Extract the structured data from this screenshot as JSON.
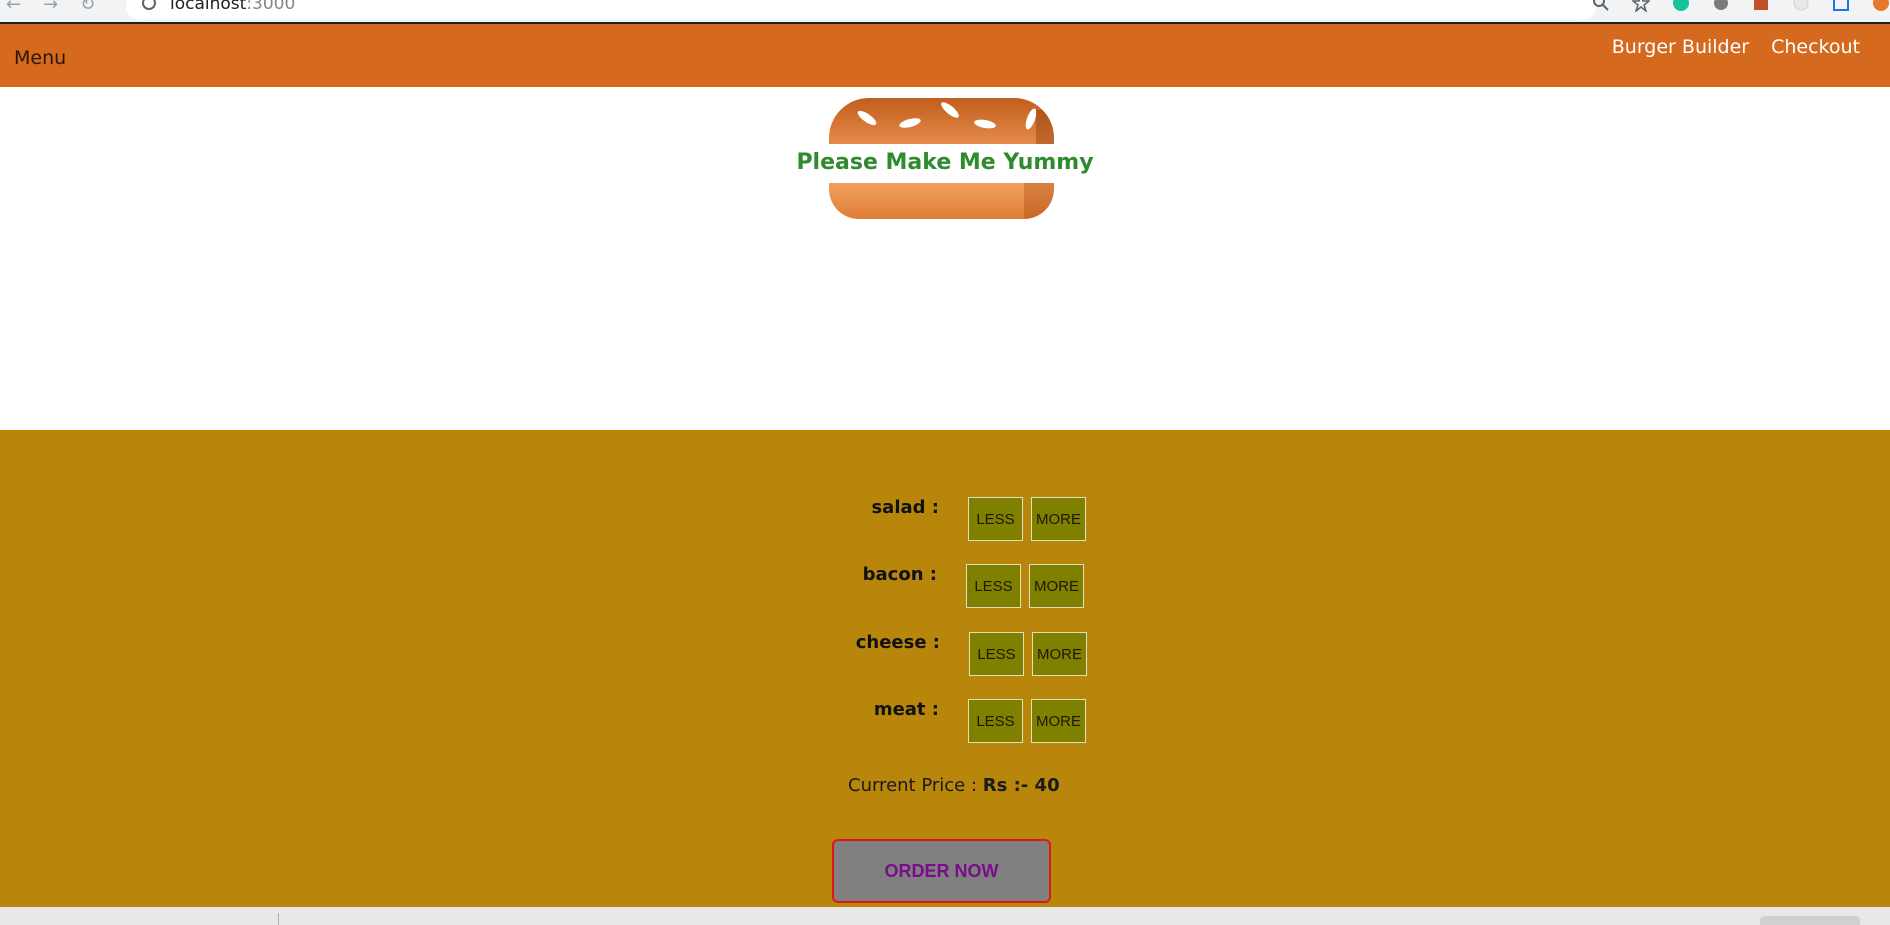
{
  "browser": {
    "url_host": "localhost",
    "url_port": ":3000",
    "nav_icons": [
      "back-arrow-icon",
      "forward-arrow-icon",
      "reload-icon"
    ],
    "tool_icons": [
      "search-icon",
      "star-icon",
      "grammarly-icon",
      "extension-icon",
      "extension-icon",
      "extension-icon",
      "extension-icon",
      "avatar-icon"
    ]
  },
  "toolbar": {
    "menu_label": "Menu",
    "nav": [
      {
        "label": "Burger Builder"
      },
      {
        "label": "Checkout"
      }
    ],
    "color": "#d56a1f"
  },
  "burger": {
    "message": "Please Make Me Yummy",
    "message_color": "#2e8b2e"
  },
  "controls": {
    "background": "#b8860b",
    "items": [
      {
        "label": "salad :",
        "less": "LESS",
        "more": "MORE"
      },
      {
        "label": "bacon :",
        "less": "LESS",
        "more": "MORE"
      },
      {
        "label": "cheese :",
        "less": "LESS",
        "more": "MORE"
      },
      {
        "label": "meat :",
        "less": "LESS",
        "more": "MORE"
      }
    ],
    "price_label": "Current Price :",
    "price_value": "Rs :- 40",
    "order_button": "ORDER NOW"
  }
}
